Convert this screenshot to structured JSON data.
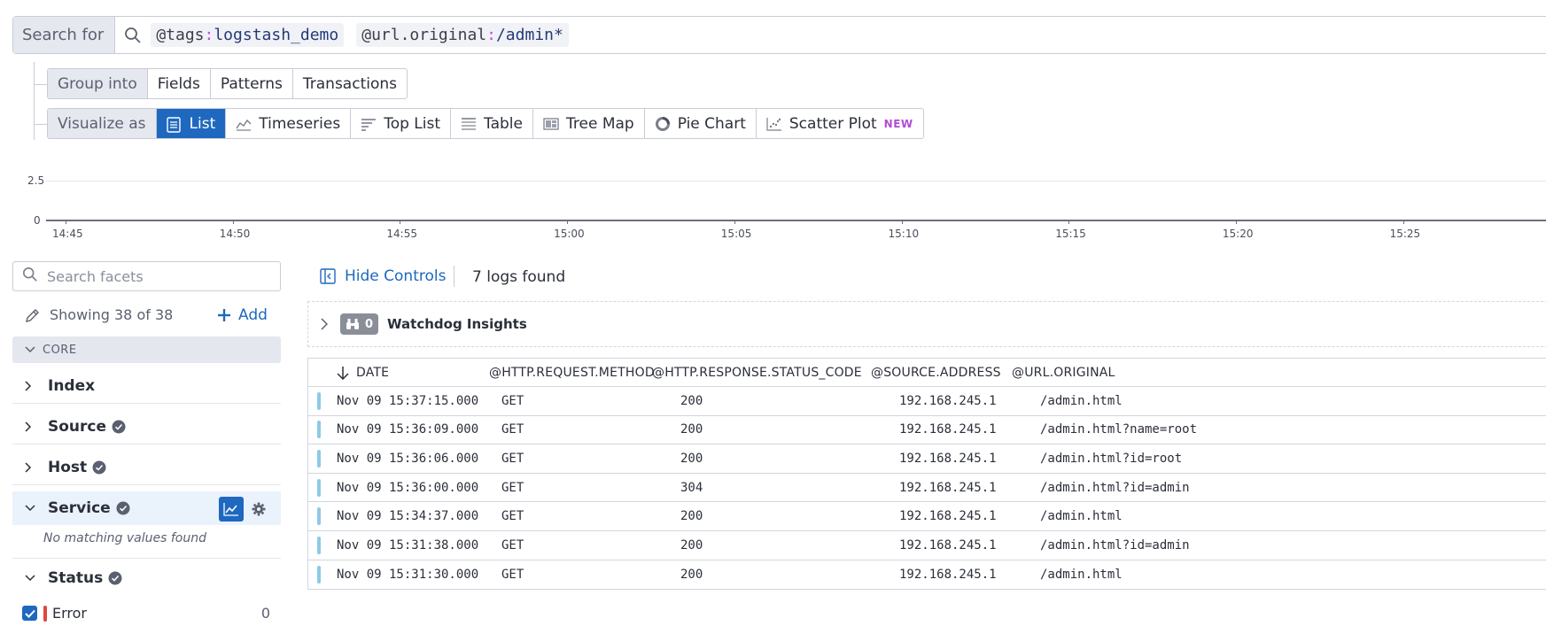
{
  "search": {
    "label": "Search for",
    "chips": [
      {
        "key": "@tags",
        "sep": ":",
        "value": "logstash_demo"
      },
      {
        "key": "@url.original",
        "sep": ":",
        "value": "/admin*"
      }
    ]
  },
  "group_into": {
    "label": "Group into",
    "options": [
      "Fields",
      "Patterns",
      "Transactions"
    ]
  },
  "visualize_as": {
    "label": "Visualize as",
    "options": [
      "List",
      "Timeseries",
      "Top List",
      "Table",
      "Tree Map",
      "Pie Chart",
      "Scatter Plot"
    ],
    "active": "List",
    "new_tag": "NEW"
  },
  "timeline": {
    "y_ticks": [
      "2.5",
      "0"
    ],
    "x_ticks": [
      "14:45",
      "14:50",
      "14:55",
      "15:00",
      "15:05",
      "15:10",
      "15:15",
      "15:20",
      "15:25"
    ]
  },
  "facets": {
    "search_placeholder": "Search facets",
    "showing": "Showing 38 of 38",
    "add_label": "Add",
    "section": "CORE",
    "items": [
      "Index",
      "Source",
      "Host",
      "Service",
      "Status"
    ],
    "service_empty": "No matching values found",
    "status_values": [
      {
        "label": "Error",
        "count": "0"
      }
    ]
  },
  "results": {
    "hide_controls": "Hide Controls",
    "count_text": "7 logs found",
    "insights_count": "0",
    "insights_label": "Watchdog Insights",
    "columns": [
      "DATE",
      "@HTTP.REQUEST.METHOD",
      "@HTTP.RESPONSE.STATUS_CODE",
      "@SOURCE.ADDRESS",
      "@URL.ORIGINAL"
    ],
    "rows": [
      [
        "Nov 09 15:37:15.000",
        "GET",
        "200",
        "192.168.245.1",
        "/admin.html"
      ],
      [
        "Nov 09 15:36:09.000",
        "GET",
        "200",
        "192.168.245.1",
        "/admin.html?name=root"
      ],
      [
        "Nov 09 15:36:06.000",
        "GET",
        "200",
        "192.168.245.1",
        "/admin.html?id=root"
      ],
      [
        "Nov 09 15:36:00.000",
        "GET",
        "304",
        "192.168.245.1",
        "/admin.html?id=admin"
      ],
      [
        "Nov 09 15:34:37.000",
        "GET",
        "200",
        "192.168.245.1",
        "/admin.html"
      ],
      [
        "Nov 09 15:31:38.000",
        "GET",
        "200",
        "192.168.245.1",
        "/admin.html?id=admin"
      ],
      [
        "Nov 09 15:31:30.000",
        "GET",
        "200",
        "192.168.245.1",
        "/admin.html"
      ]
    ]
  },
  "colors": {
    "accent": "#1e68bf",
    "error": "#e0463f",
    "info_marker": "#8ec9e6",
    "new_tag": "#b24bd6"
  }
}
